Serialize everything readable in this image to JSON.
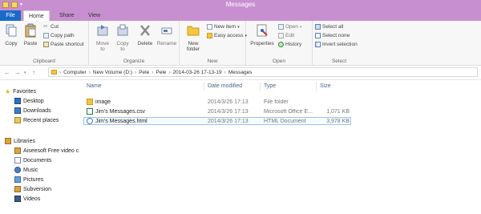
{
  "window": {
    "title": "Messages"
  },
  "tabs": [
    {
      "label": "File"
    },
    {
      "label": "Home"
    },
    {
      "label": "Share"
    },
    {
      "label": "View"
    }
  ],
  "ribbon": {
    "clipboard": {
      "label": "Clipboard",
      "copy": "Copy",
      "paste": "Paste",
      "cut": "Cut",
      "copy_path": "Copy path",
      "paste_shortcut": "Paste shortcut"
    },
    "organize": {
      "label": "Organize",
      "move_to": "Move to",
      "copy_to": "Copy to",
      "delete": "Delete",
      "rename": "Rename"
    },
    "new": {
      "label": "New",
      "new_folder": "New folder",
      "new_item": "New item",
      "easy_access": "Easy access"
    },
    "open": {
      "label": "Open",
      "properties": "Properties",
      "open": "Open",
      "edit": "Edit",
      "history": "History"
    },
    "select": {
      "label": "Select",
      "select_all": "Select all",
      "select_none": "Select none",
      "invert_selection": "Invert selection"
    }
  },
  "address": {
    "segments": [
      "Computer",
      "New Volume (D:)",
      "Pele",
      "Pele",
      "2014-03-26 17-13-19",
      "Messages"
    ]
  },
  "navigation": {
    "favorites": {
      "label": "Favorites",
      "items": [
        "Desktop",
        "Downloads",
        "Recent places"
      ]
    },
    "libraries": {
      "label": "Libraries",
      "items": [
        "Aiseesoft Free video c",
        "Documents",
        "Music",
        "Pictures",
        "Subversion",
        "Videos"
      ]
    }
  },
  "columns": [
    "Name",
    "Date modified",
    "Type",
    "Size"
  ],
  "files": [
    {
      "name": "image",
      "date": "2014/3/26 17:13",
      "type": "File folder",
      "size": "",
      "icon": "folder-icon"
    },
    {
      "name": "Jim's Messages.csv",
      "date": "2014/3/26 17:13",
      "type": "Microsoft Office E...",
      "size": "1,071 KB",
      "icon": "csv-file-icon"
    },
    {
      "name": "Jim's Messages.html",
      "date": "2014/3/26 17:13",
      "type": "HTML Document",
      "size": "3,978 KB",
      "icon": "html-file-icon"
    }
  ],
  "colors": {
    "titlebar": "#c78fd0",
    "file_tab": "#1b6ac9",
    "folder": "#f5c542",
    "selection_border": "#9bc5ea"
  }
}
